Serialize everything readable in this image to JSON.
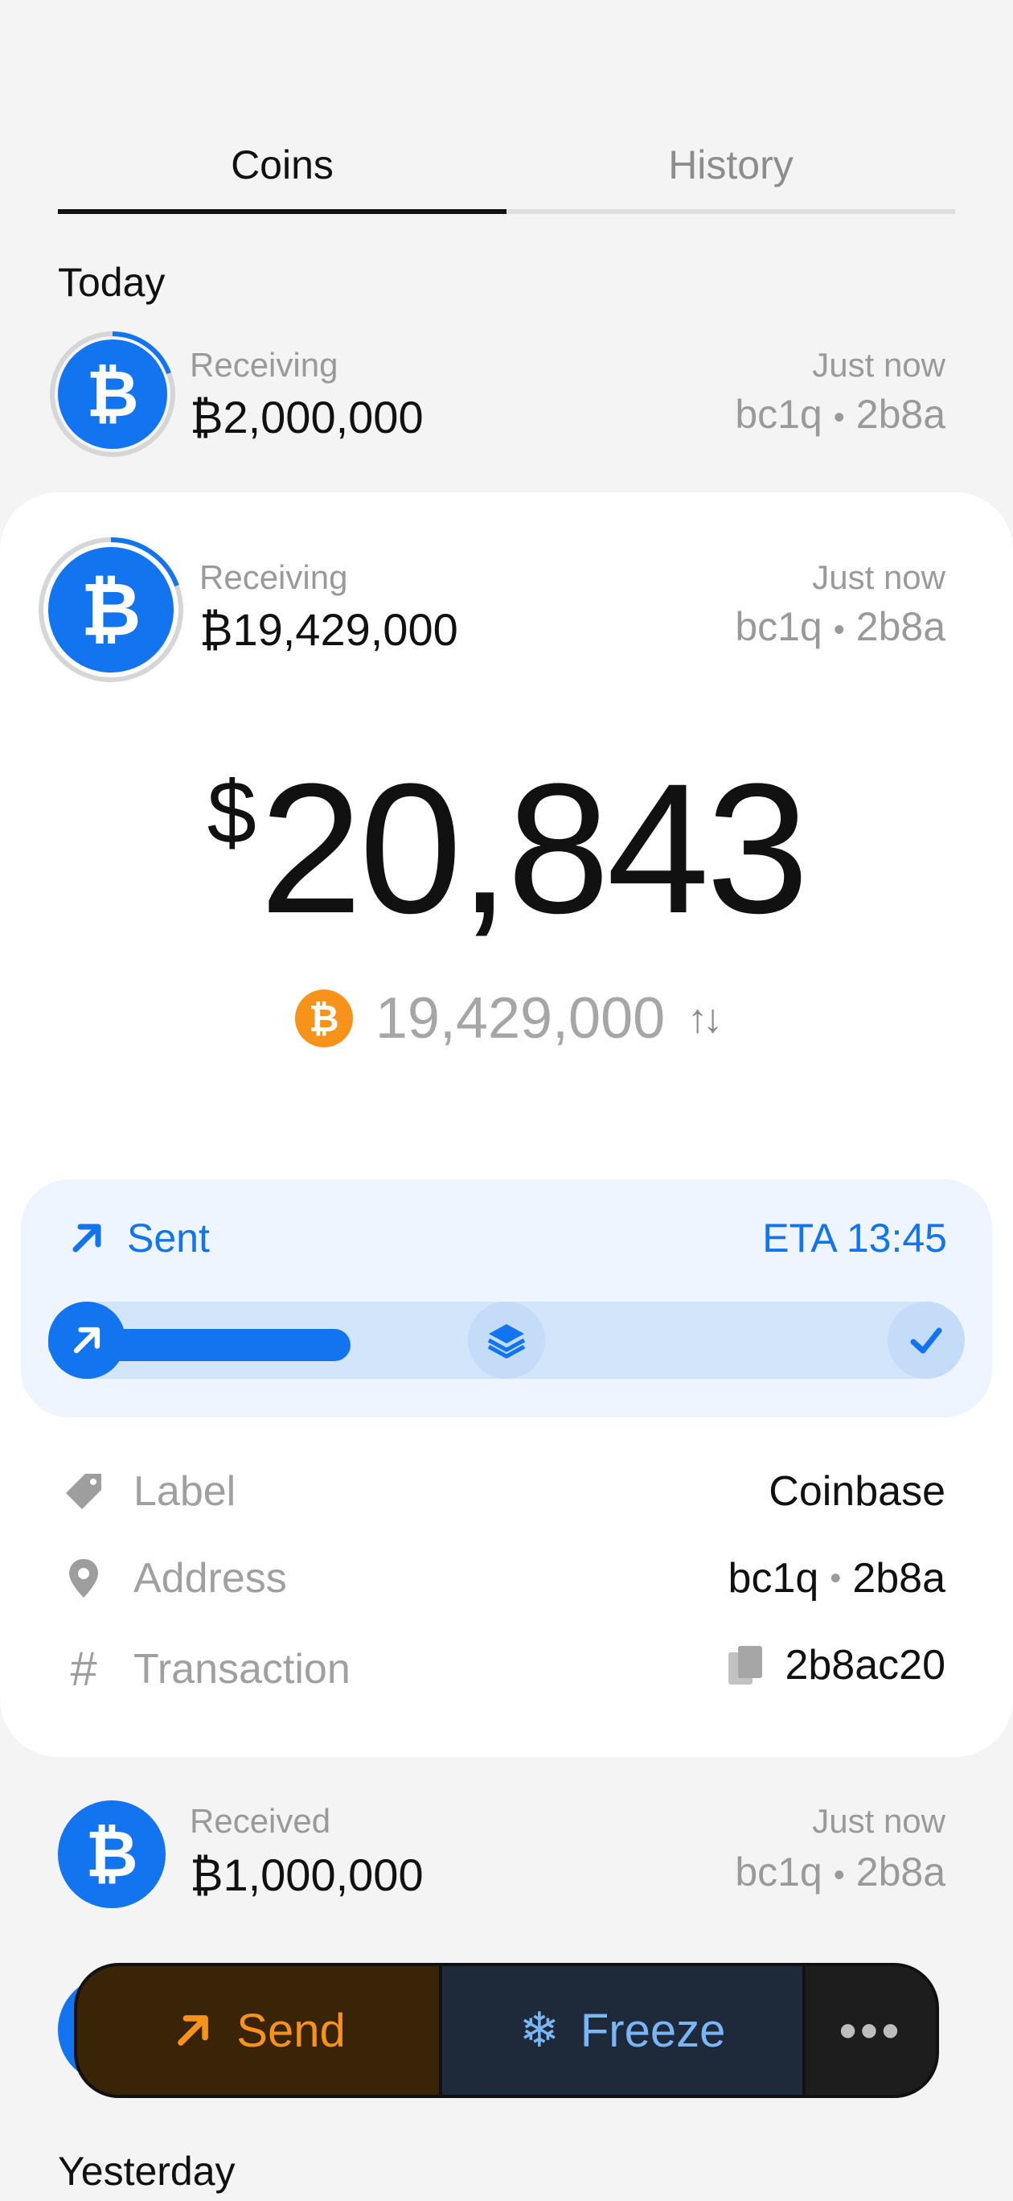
{
  "tabs": {
    "coins": "Coins",
    "history": "History"
  },
  "sections": {
    "today": "Today",
    "yesterday": "Yesterday"
  },
  "rows": [
    {
      "label": "Receiving",
      "amount": "₿2,000,000",
      "time": "Just now",
      "addr_prefix": "bc1q",
      "addr_suffix": "2b8a"
    },
    {
      "label": "Receiving",
      "amount": "₿19,429,000",
      "time": "Just now",
      "addr_prefix": "bc1q",
      "addr_suffix": "2b8a"
    },
    {
      "label": "Received",
      "amount": "₿1,000,000",
      "time": "Just now",
      "addr_prefix": "bc1q",
      "addr_suffix": "2b8a"
    }
  ],
  "detail": {
    "usd_symbol": "$",
    "usd_value": "20,843",
    "btc_value": "19,429,000",
    "status": {
      "label": "Sent",
      "eta": "ETA 13:45",
      "progress": 0.33
    },
    "fields": {
      "label": {
        "name": "Label",
        "value": "Coinbase"
      },
      "address": {
        "name": "Address",
        "prefix": "bc1q",
        "suffix": "2b8a"
      },
      "transaction": {
        "name": "Transaction",
        "value": "2b8ac20"
      }
    }
  },
  "actions": {
    "send": "Send",
    "freeze": "Freeze",
    "more": "•••"
  },
  "colors": {
    "accent": "#1274ee",
    "bitcoin": "#f7931a",
    "freeze": "#79b5f7"
  }
}
